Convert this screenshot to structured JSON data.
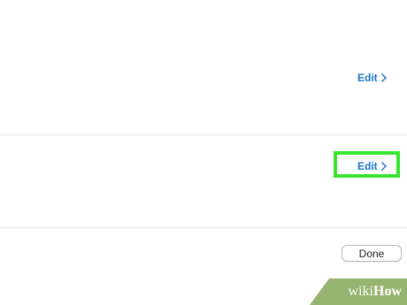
{
  "sections": {
    "first": {
      "edit_label": "Edit"
    },
    "second": {
      "edit_label": "Edit"
    }
  },
  "footer": {
    "done_label": "Done"
  },
  "watermark": {
    "wiki": "wiki",
    "how": "How"
  },
  "colors": {
    "link_blue": "#1b73c9",
    "highlight_green": "#39e62f",
    "divider_gray": "#e6e6e6",
    "watermark_green": "#96b36f"
  },
  "icons": {
    "edit_chevron": "chevron-right-icon"
  }
}
